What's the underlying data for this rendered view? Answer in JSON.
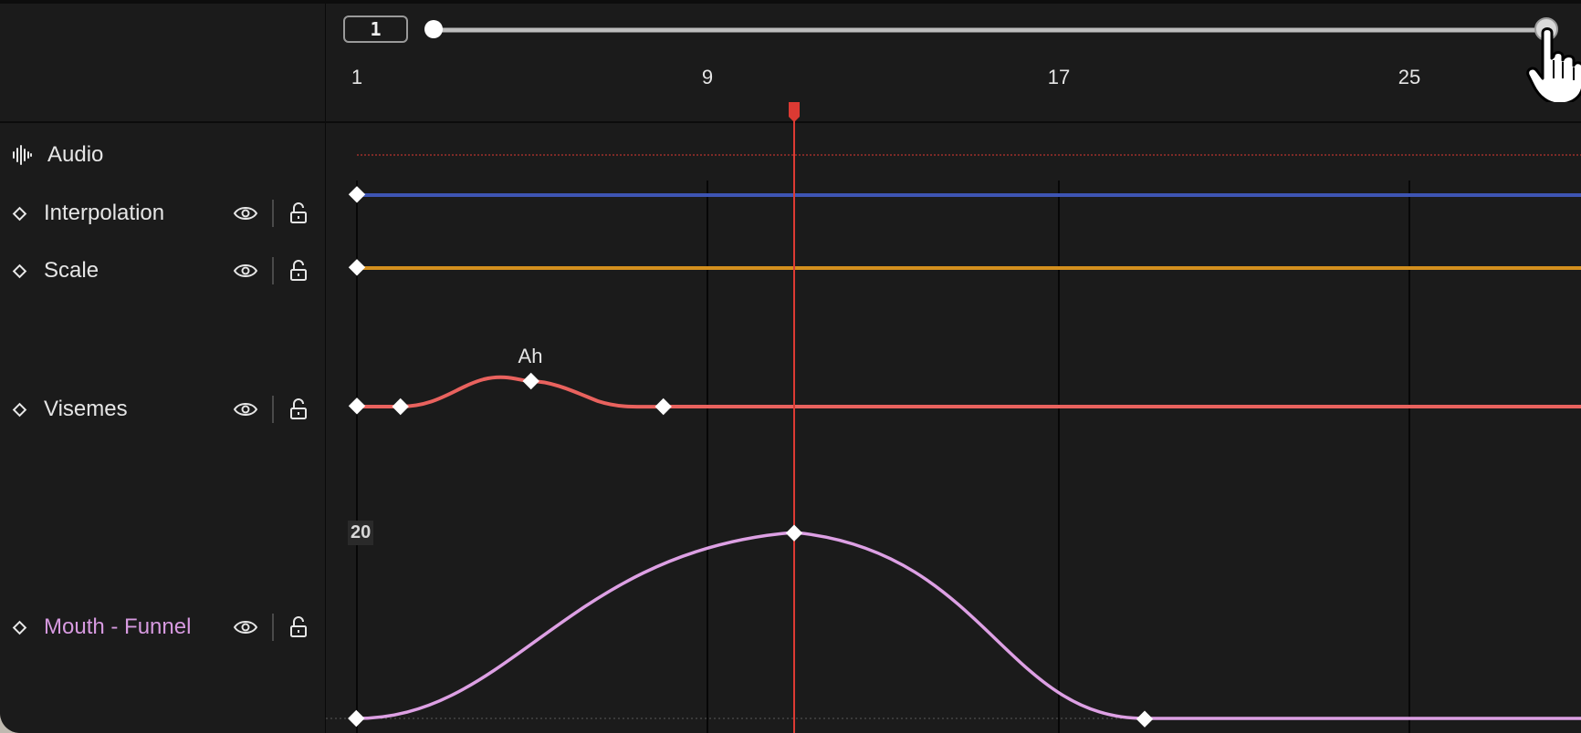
{
  "frame_input": {
    "value": "1"
  },
  "scrubber": {
    "position": 1.0
  },
  "ruler": {
    "ticks": [
      "1",
      "9",
      "17",
      "25"
    ]
  },
  "playhead": {
    "frame": 11
  },
  "tracks": [
    {
      "name": "Audio"
    },
    {
      "name": "Interpolation",
      "color": "#3e55b4"
    },
    {
      "name": "Scale",
      "color": "#d4901e"
    },
    {
      "name": "Visemes",
      "color": "#e9625e",
      "viseme_label": "Ah"
    },
    {
      "name": "Mouth - Funnel",
      "color": "#dda0e4",
      "value_label": "20"
    }
  ],
  "colors": {
    "background": "#1b1b1b",
    "playhead": "#dc3a33",
    "grid": "#070707",
    "funnel_text": "#d79ae0"
  },
  "icons": {
    "audio": "audio-waveform-icon",
    "visibility": "eye-icon",
    "lock": "unlock-icon",
    "keyframe": "diamond-icon",
    "cursor": "hand-pointer-icon"
  }
}
